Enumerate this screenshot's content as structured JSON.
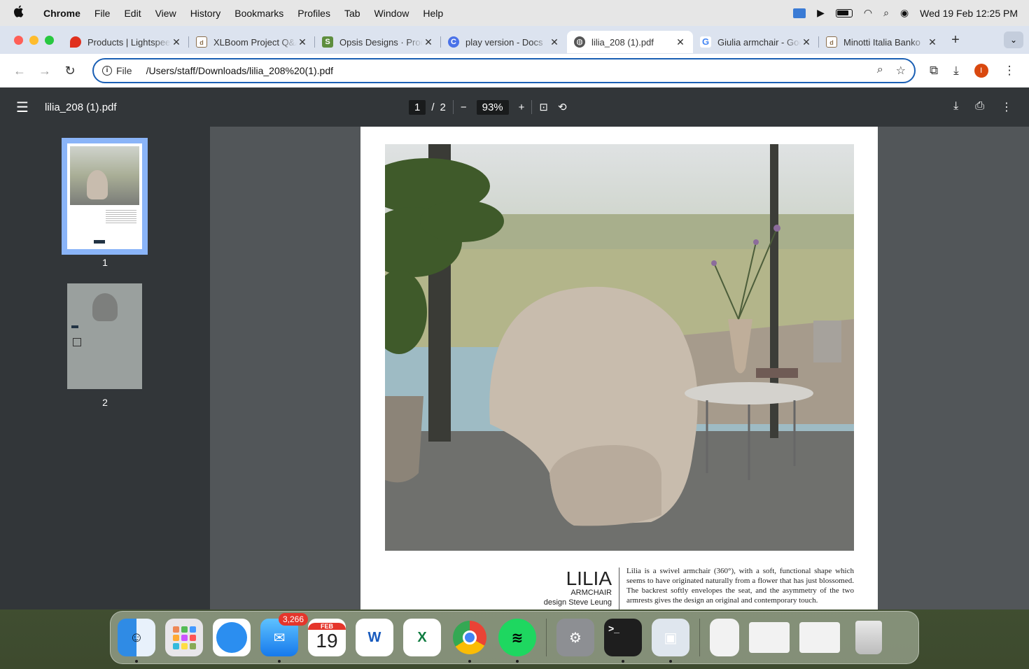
{
  "menubar": {
    "app_name": "Chrome",
    "items": [
      "File",
      "Edit",
      "View",
      "History",
      "Bookmarks",
      "Profiles",
      "Tab",
      "Window",
      "Help"
    ],
    "datetime": "Wed 19 Feb  12:25 PM"
  },
  "tabs": [
    {
      "title": "Products | Lightspeed",
      "favicon_color": "#e0301e",
      "active": false
    },
    {
      "title": "XLBoom Project Q&A",
      "favicon_color": "#8a6d4b",
      "active": false
    },
    {
      "title": "Opsis Designs · Products",
      "favicon_color": "#5e8e3e",
      "active": false
    },
    {
      "title": "play version - Docs",
      "favicon_color": "#4a72e8",
      "active": false
    },
    {
      "title": "lilia_208 (1).pdf",
      "favicon_color": "#555555",
      "active": true
    },
    {
      "title": "Giulia armchair - Google",
      "favicon_color": "#4285f4",
      "active": false
    },
    {
      "title": "Minotti Italia Banko",
      "favicon_color": "#8a6d4b",
      "active": false
    }
  ],
  "toolbar": {
    "site_info_label": "File",
    "url": "/Users/staff/Downloads/lilia_208%20(1).pdf",
    "profile_initial": "I"
  },
  "pdf": {
    "filename": "lilia_208 (1).pdf",
    "current_page": "1",
    "page_separator": "/",
    "total_pages": "2",
    "zoom": "93%",
    "thumbnails": [
      "1",
      "2"
    ],
    "product_name": "LILIA",
    "product_type": "ARMCHAIR",
    "designer": "design Steve Leung",
    "description": "Lilia is a swivel armchair (360°), with a soft, functional shape which seems to have originated naturally from a flower that has just blossomed. The backrest softly envelopes the seat, and the asymmetry of the two armrests gives the design an original and contemporary touch."
  },
  "dock": {
    "mail_badge": "3,266",
    "calendar_month": "FEB",
    "calendar_day": "19"
  }
}
